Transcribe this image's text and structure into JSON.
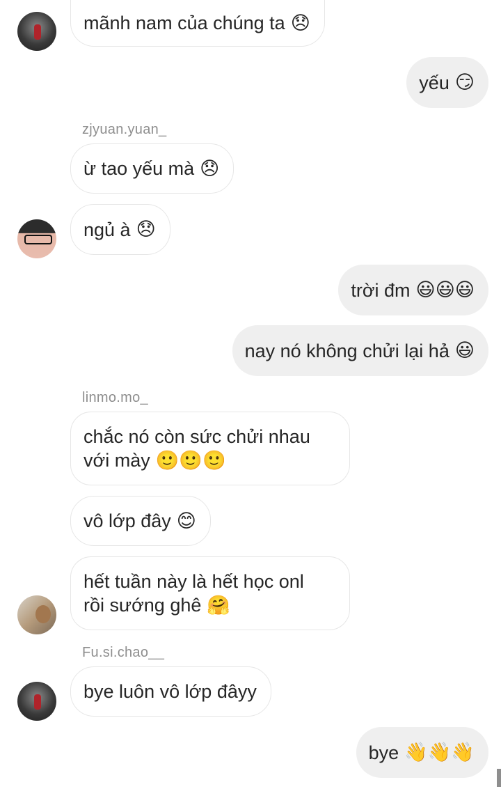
{
  "messages": [
    {
      "side": "in",
      "text": "mãnh nam của chúng ta",
      "emoji": "😞"
    },
    {
      "side": "out",
      "text": "yếu",
      "emoji": "😏"
    },
    {
      "sender": "zjyuan.yuan_"
    },
    {
      "side": "in",
      "text": "ừ tao yếu mà",
      "emoji": "😞"
    },
    {
      "side": "in",
      "text": "ngủ à",
      "emoji": "😞"
    },
    {
      "side": "out",
      "text": "trời đm",
      "emoji": "😃😃😃"
    },
    {
      "side": "out",
      "text": "nay nó không chửi lại hả",
      "emoji": "😃"
    },
    {
      "sender": "linmo.mo_"
    },
    {
      "side": "in",
      "lines": [
        "chắc nó còn sức chửi nhau",
        "với mày"
      ],
      "emoji": "🙂🙂🙂"
    },
    {
      "side": "in",
      "text": "vô lớp đây",
      "emoji": "😊"
    },
    {
      "side": "in",
      "lines": [
        "hết tuần này là hết học onl",
        "rồi sướng ghê"
      ],
      "emoji": "🤗"
    },
    {
      "sender": "Fu.si.chao__"
    },
    {
      "side": "in",
      "text": "bye luôn vô lớp đâyy",
      "emoji": ""
    },
    {
      "side": "out",
      "text": "bye",
      "emoji": "👋👋👋"
    }
  ],
  "m": {
    "0": {
      "text": "mãnh nam của chúng ta",
      "emoji": "😞"
    },
    "1": {
      "text": "yếu",
      "emoji": "😏"
    },
    "2": {
      "sender": "zjyuan.yuan_"
    },
    "3": {
      "text": "ừ tao yếu mà",
      "emoji": "😞"
    },
    "4": {
      "text": "ngủ à",
      "emoji": "😞"
    },
    "5": {
      "text": "trời đm",
      "emoji": "😃😃😃"
    },
    "6": {
      "text": "nay nó không chửi lại hả",
      "emoji": "😃"
    },
    "7": {
      "sender": "linmo.mo_"
    },
    "8": {
      "line1": "chắc nó còn sức chửi nhau",
      "line2": "với mày",
      "emoji": "🙂🙂🙂"
    },
    "9": {
      "text": "vô lớp đây",
      "emoji": "😊"
    },
    "10": {
      "line1": "hết tuần này là hết học onl",
      "line2": "rồi sướng ghê",
      "emoji": "🤗"
    },
    "11": {
      "sender": "Fu.si.chao__"
    },
    "12": {
      "text": "bye luôn vô lớp đâyy"
    },
    "13": {
      "text": "bye",
      "emoji": "👋👋👋"
    }
  },
  "colors": {
    "incoming_bg": "#ffffff",
    "incoming_border": "#e6e6e6",
    "outgoing_bg": "#efefef",
    "text": "#262626",
    "sender_name": "#8e8e8e"
  }
}
